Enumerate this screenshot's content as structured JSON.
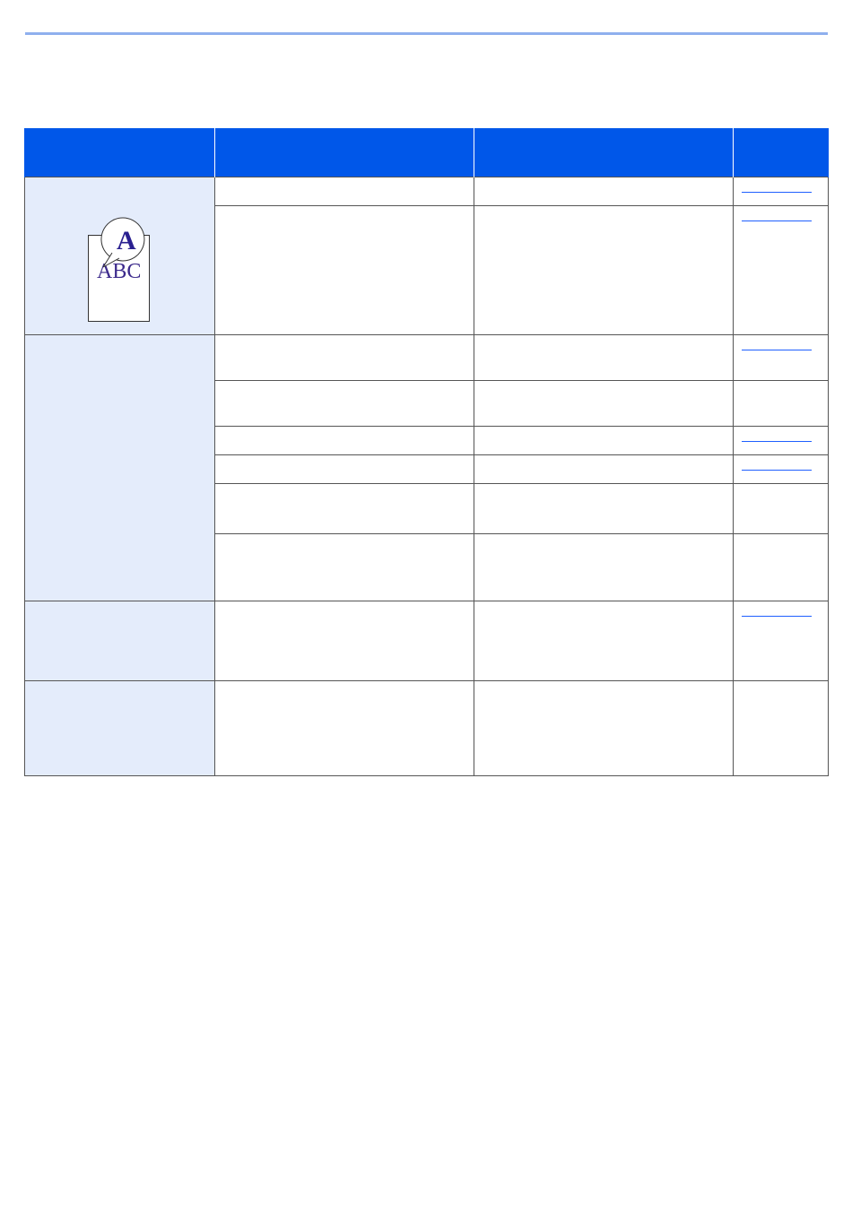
{
  "page": {
    "rule_color": "#8fb0ee",
    "header_color": "#0057e9",
    "category_color": "#e4ecfb",
    "link_color": "#1f5fff"
  },
  "table": {
    "headers": [
      "",
      "",
      "",
      ""
    ],
    "illustration": {
      "name": "blurred-text-sample",
      "text": "ABC",
      "magnified_letter": "A",
      "text_color": "#3c2a8c"
    }
  }
}
